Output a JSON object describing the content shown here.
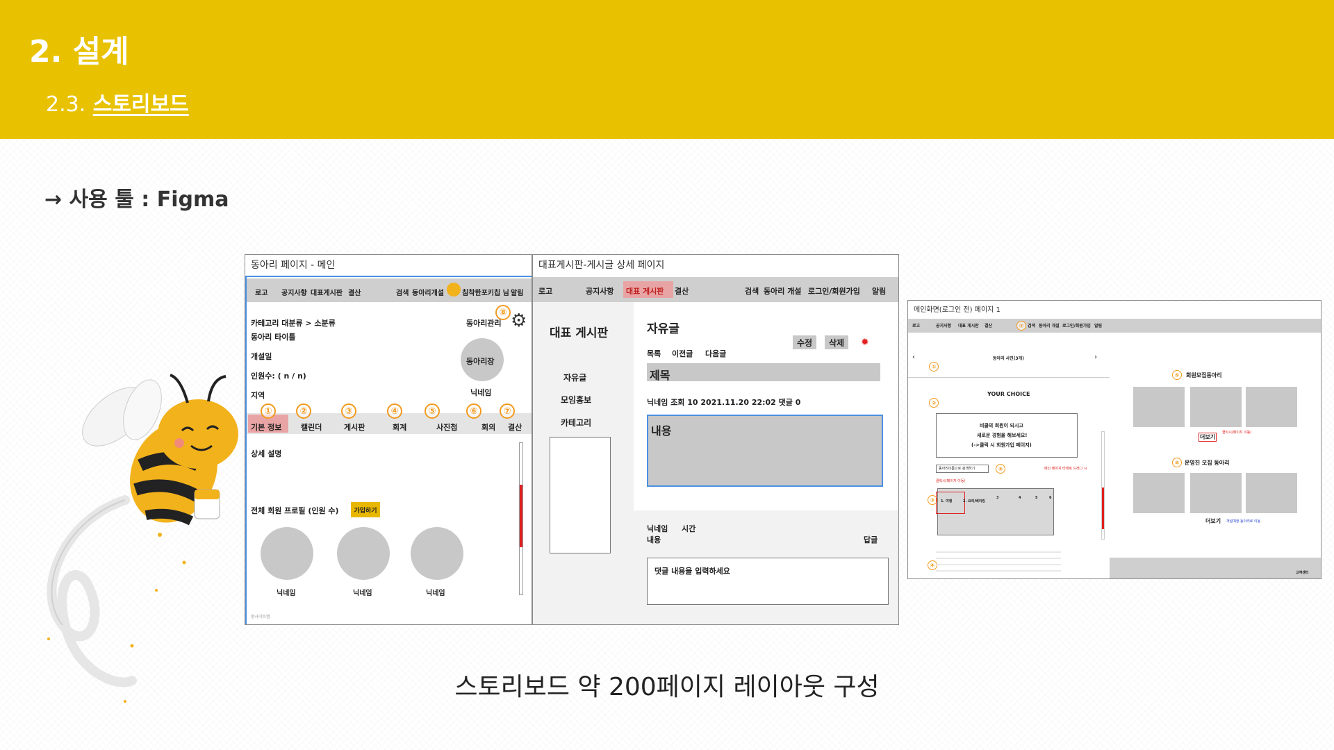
{
  "slide": {
    "section_title": "2.  설계",
    "subsection_number": "2.3.",
    "subsection_label": "스토리보드",
    "tool_line": "→ 사용 툴 : Figma",
    "caption": "스토리보드 약 200페이지 레이아웃 구성"
  },
  "colors": {
    "header": "#e8c200",
    "badge": "#f29a1e",
    "highlight_red": "#e02020",
    "selection_blue": "#4a90e2"
  },
  "panel1": {
    "title": "동아리 페이지 - 메인",
    "nav": [
      "로고",
      "공지사항",
      "대표게시판",
      "결산",
      "검색",
      "동아리개설",
      "침착한포키칩 님",
      "알림"
    ],
    "category": "카테고리 대분류 > 소분류",
    "club_title": "동아리 타이틀",
    "open_date": "개설일",
    "members": "인원수: ( n / n)",
    "region": "지역",
    "manage": "동아리관리",
    "leader": "동아리장",
    "nickname": "닉네임",
    "tabs": [
      "기본 정보",
      "캘린더",
      "게시판",
      "회계",
      "사진첩",
      "회의",
      "결산"
    ],
    "badges": [
      "①",
      "②",
      "③",
      "④",
      "⑤",
      "⑥",
      "⑦",
      "⑧"
    ],
    "detail": "상세 설명",
    "profiles": "전체 회원 프로필 (인원 수)",
    "join": "가입하기",
    "member_names": [
      "닉네임",
      "닉네임",
      "닉네임"
    ],
    "footer": "중사이트맵"
  },
  "panel2": {
    "title": "대표게시판-게시글 상세 페이지",
    "nav": [
      "로고",
      "공지사항",
      "대표 게시판",
      "결산",
      "검색",
      "동아리 개설",
      "로그인/회원가입",
      "알림"
    ],
    "board_name": "대표 게시판",
    "side_menu": [
      "자유글",
      "모임홍보",
      "카테고리"
    ],
    "category": "자유글",
    "edit": "수정",
    "delete": "삭제",
    "post_nav": [
      "목록",
      "이전글",
      "다음글"
    ],
    "post_title": "제목",
    "meta": "닉네임   조회 10   2021.11.20 22:02   댓글 0",
    "content": "내용",
    "comment_author": "닉네임",
    "comment_time": "시간",
    "comment_content": "내용",
    "reply": "답글",
    "comment_placeholder": "댓글 내용을 입력하세요"
  },
  "panel3": {
    "title": "메인화면(로그인 전) 페이지 1",
    "nav": [
      "로고",
      "공지사항",
      "대표 게시판",
      "결산",
      "검색",
      "동아리 개설",
      "로그인/회원가입",
      "알림"
    ],
    "photo": "동아리 사진(3개)",
    "your_choice": "YOUR CHOICE",
    "promo": [
      "비클의 회원이 되시고",
      "새로운 경험을 해보세요!",
      "(->클릭 시 회원가입 페이지)"
    ],
    "search_btn": "동아리이름으로 검색하기",
    "drag_hint": "메인 페이지 타래로 드래그 시",
    "click_hint": "클릭시(페이지 이동)",
    "cats": [
      "1. 여행",
      "2. 요리/베이킹",
      "3",
      "4",
      "5",
      "6"
    ],
    "recruit": "회원모집동아리",
    "more": "더보기",
    "more_hint": "클릭시(페이지 이동)",
    "running": "운영진 모집 동아리",
    "more2": "더보기",
    "more2_hint": "개설예정 동아리로 이동",
    "customer": "고객센터",
    "badges": [
      "①",
      "②",
      "③",
      "④",
      "⑤",
      "⑥",
      "⑦",
      "⑧"
    ]
  }
}
